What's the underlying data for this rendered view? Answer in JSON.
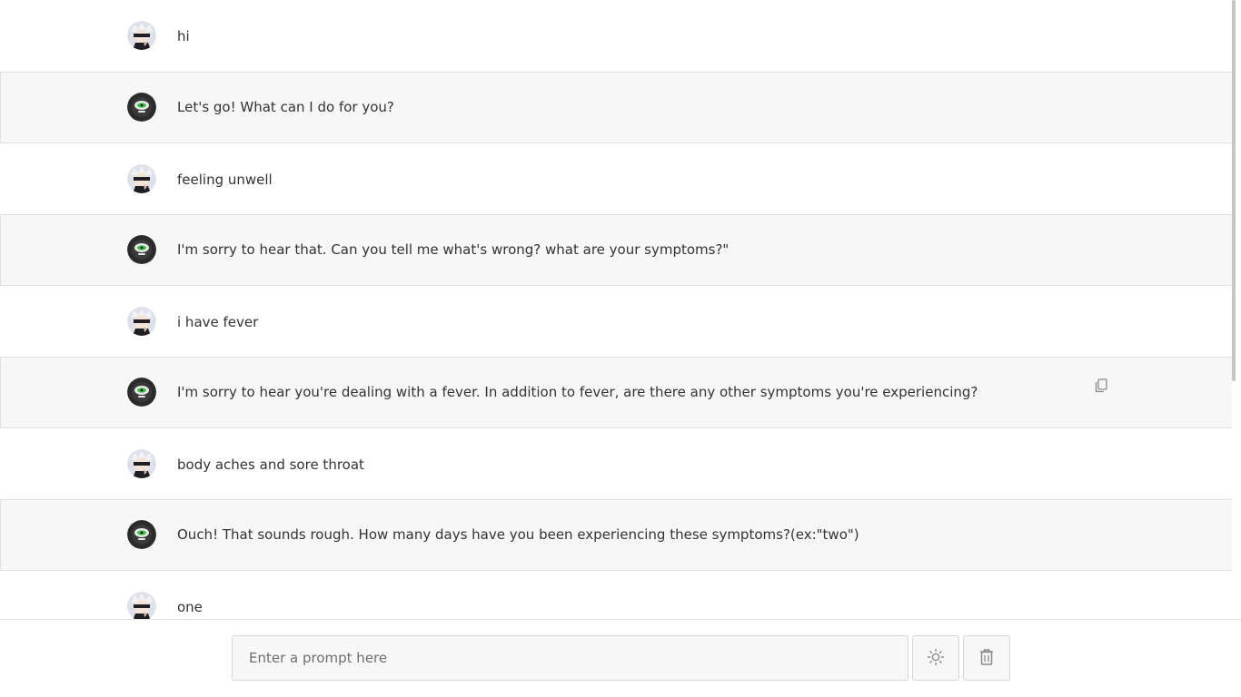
{
  "colors": {
    "bot_row_bg": "#f7f7f7",
    "user_row_bg": "#ffffff",
    "text": "#333333",
    "bot_avatar_eye": "#3fbf4a"
  },
  "messages": [
    {
      "role": "user",
      "text": "hi",
      "avatar": "user-avatar"
    },
    {
      "role": "bot",
      "text": "Let's go! What can I do for you?",
      "avatar": "bot-avatar"
    },
    {
      "role": "user",
      "text": "feeling unwell",
      "avatar": "user-avatar"
    },
    {
      "role": "bot",
      "text": "I'm sorry to hear that. Can you tell me what's wrong? what are your symptoms?\"",
      "avatar": "bot-avatar"
    },
    {
      "role": "user",
      "text": "i have fever",
      "avatar": "user-avatar"
    },
    {
      "role": "bot",
      "text": "I'm sorry to hear you're dealing with a fever. In addition to fever, are there any other symptoms you're experiencing?",
      "avatar": "bot-avatar",
      "show_copy": true
    },
    {
      "role": "user",
      "text": "body aches and sore throat",
      "avatar": "user-avatar"
    },
    {
      "role": "bot",
      "text": "Ouch! That sounds rough. How many days have you been experiencing these symptoms?(ex:\"two\")",
      "avatar": "bot-avatar"
    },
    {
      "role": "user",
      "text": "one",
      "avatar": "user-avatar"
    }
  ],
  "composer": {
    "placeholder": "Enter a prompt here",
    "value": "",
    "theme_icon": "sun-icon",
    "delete_icon": "trash-icon"
  }
}
